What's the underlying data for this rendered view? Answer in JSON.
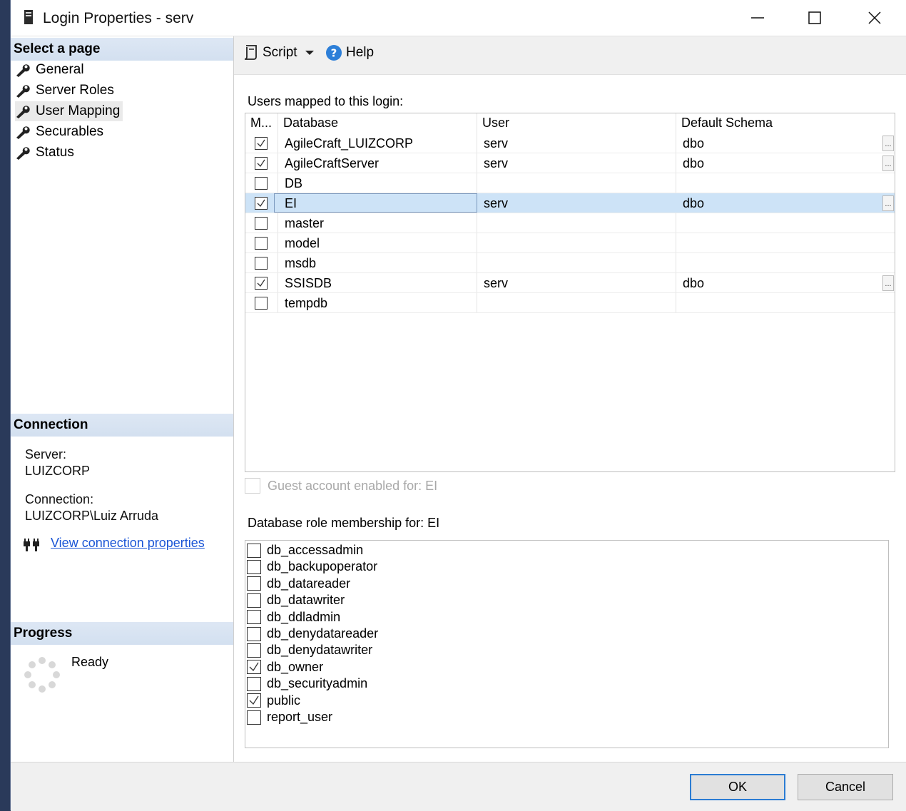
{
  "window": {
    "title": "Login Properties - serv"
  },
  "left": {
    "select_page_header": "Select a page",
    "pages": [
      {
        "label": "General"
      },
      {
        "label": "Server Roles"
      },
      {
        "label": "User Mapping",
        "selected": true
      },
      {
        "label": "Securables"
      },
      {
        "label": "Status"
      }
    ],
    "connection_header": "Connection",
    "server_label": "Server:",
    "server_value": "LUIZCORP",
    "connection_label": "Connection:",
    "connection_value": "LUIZCORP\\Luiz Arruda",
    "view_conn_link": "View connection properties",
    "progress_header": "Progress",
    "progress_status": "Ready"
  },
  "toolbar": {
    "script_label": "Script",
    "help_label": "Help"
  },
  "mapping": {
    "section_label": "Users mapped to this login:",
    "columns": [
      "M...",
      "Database",
      "User",
      "Default Schema"
    ],
    "rows": [
      {
        "map": true,
        "database": "AgileCraft_LUIZCORP",
        "user": "serv",
        "schema": "dbo",
        "ellipsis": "..."
      },
      {
        "map": true,
        "database": "AgileCraftServer",
        "user": "serv",
        "schema": "dbo",
        "ellipsis": "..."
      },
      {
        "map": false,
        "database": "DB",
        "user": "",
        "schema": "",
        "ellipsis": ""
      },
      {
        "map": true,
        "database": "EI",
        "user": "serv",
        "schema": "dbo",
        "ellipsis": "...",
        "selected": true
      },
      {
        "map": false,
        "database": "master",
        "user": "",
        "schema": "",
        "ellipsis": ""
      },
      {
        "map": false,
        "database": "model",
        "user": "",
        "schema": "",
        "ellipsis": ""
      },
      {
        "map": false,
        "database": "msdb",
        "user": "",
        "schema": "",
        "ellipsis": ""
      },
      {
        "map": true,
        "database": "SSISDB",
        "user": "serv",
        "schema": "dbo",
        "ellipsis": "..."
      },
      {
        "map": false,
        "database": "tempdb",
        "user": "",
        "schema": "",
        "ellipsis": ""
      }
    ]
  },
  "guest": {
    "label": "Guest account enabled for: EI",
    "checked": false,
    "enabled": false
  },
  "roles": {
    "section_label": "Database role membership for: EI",
    "items": [
      {
        "name": "db_accessadmin",
        "checked": false
      },
      {
        "name": "db_backupoperator",
        "checked": false
      },
      {
        "name": "db_datareader",
        "checked": false
      },
      {
        "name": "db_datawriter",
        "checked": false
      },
      {
        "name": "db_ddladmin",
        "checked": false
      },
      {
        "name": "db_denydatareader",
        "checked": false
      },
      {
        "name": "db_denydatawriter",
        "checked": false
      },
      {
        "name": "db_owner",
        "checked": true
      },
      {
        "name": "db_securityadmin",
        "checked": false
      },
      {
        "name": "public",
        "checked": true
      },
      {
        "name": "report_user",
        "checked": false
      }
    ]
  },
  "buttons": {
    "ok": "OK",
    "cancel": "Cancel"
  }
}
